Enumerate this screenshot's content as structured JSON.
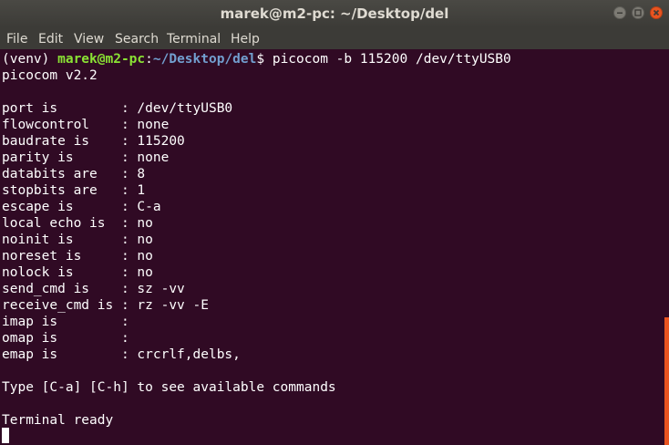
{
  "window": {
    "title": "marek@m2-pc: ~/Desktop/del"
  },
  "menubar": {
    "items": [
      "File",
      "Edit",
      "View",
      "Search",
      "Terminal",
      "Help"
    ]
  },
  "prompt": {
    "env": "(venv) ",
    "user_host": "marek@m2-pc",
    "colon": ":",
    "path": "~/Desktop/del",
    "dollar": "$ ",
    "command": "picocom -b 115200 /dev/ttyUSB0"
  },
  "output": {
    "version": "picocom v2.2",
    "settings": [
      "port is        : /dev/ttyUSB0",
      "flowcontrol    : none",
      "baudrate is    : 115200",
      "parity is      : none",
      "databits are   : 8",
      "stopbits are   : 1",
      "escape is      : C-a",
      "local echo is  : no",
      "noinit is      : no",
      "noreset is     : no",
      "nolock is      : no",
      "send_cmd is    : sz -vv",
      "receive_cmd is : rz -vv -E",
      "imap is        : ",
      "omap is        : ",
      "emap is        : crcrlf,delbs,"
    ],
    "help_hint": "Type [C-a] [C-h] to see available commands",
    "status": "Terminal ready"
  },
  "colors": {
    "background": "#300a24",
    "user_host": "#8ae234",
    "path": "#729fcf",
    "scrollbar": "#e95420",
    "close_button": "#e95420"
  }
}
